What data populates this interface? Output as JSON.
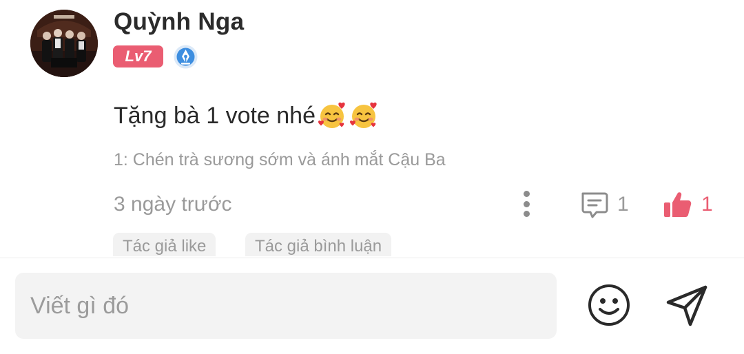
{
  "comment": {
    "username": "Quỳnh Nga",
    "level": "Lv7",
    "text": "Tặng bà 1 vote nhé",
    "text_emojis": [
      "smiling-face-with-hearts",
      "smiling-face-with-hearts"
    ],
    "chapter_ref": "1: Chén trà sương sớm và ánh mắt Cậu Ba",
    "timestamp": "3 ngày trước",
    "reply_count": "1",
    "like_count": "1",
    "tags": [
      "Tác giả like",
      "Tác giả bình luận"
    ]
  },
  "composer": {
    "placeholder": "Viết gì đó"
  },
  "colors": {
    "accent": "#ea5d72",
    "muted_text": "#9a9a9a",
    "primary_text": "#2a2a2a",
    "badge_blue": "#3d8ee0"
  }
}
